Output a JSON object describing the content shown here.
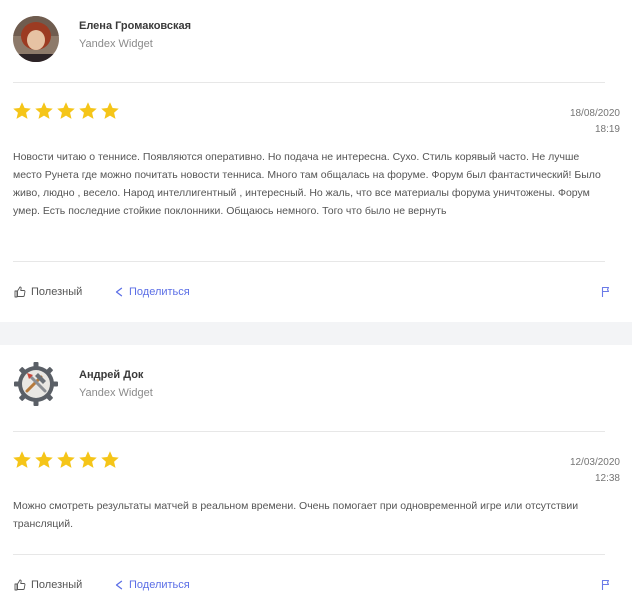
{
  "reviews": [
    {
      "author": "Елена Громаковская",
      "source": "Yandex Widget",
      "rating": 5,
      "date": "18/08/2020",
      "time": "18:19",
      "text": "Новости читаю о теннисе. Появляются оперативно. Но подача не интересна. Сухо. Стиль корявый часто. Не лучше место Рунета где можно почитать новости тенниса. Много там общалась на форуме. Форум был фантастический! Было живо, людно , весело. Народ интеллигентный , интересный. Но жаль, что все материалы форума уничтожены. Форум умер. Есть последние стойкие поклонники. Общаюсь немного. Того что было не вернуть",
      "useful_label": "Полезный",
      "share_label": "Поделиться",
      "avatar_icon": "user-photo"
    },
    {
      "author": "Андрей Док",
      "source": "Yandex Widget",
      "rating": 5,
      "date": "12/03/2020",
      "time": "12:38",
      "text": "Можно смотреть результаты матчей в реальном времени. Очень помогает при одновременной игре или отсутствии трансляций.",
      "useful_label": "Полезный",
      "share_label": "Поделиться",
      "avatar_icon": "gear-hammer-icon"
    }
  ],
  "colors": {
    "star": "#f5c518",
    "share": "#5b6ee6",
    "flag": "#6a7ae8",
    "page_gap": "#f3f4f6"
  }
}
